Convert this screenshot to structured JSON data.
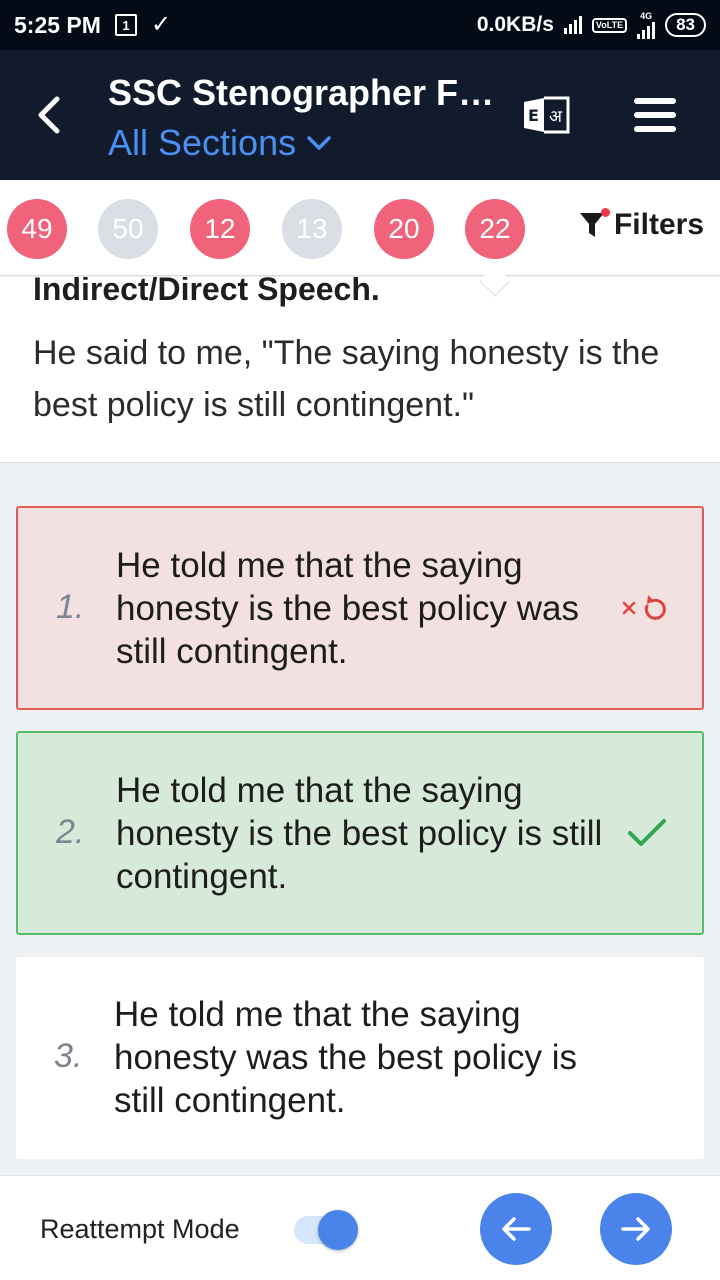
{
  "status_bar": {
    "time": "5:25 PM",
    "notif_box": "1",
    "network_speed": "0.0KB/s",
    "volte": "VoLTE",
    "net_type": "4G",
    "battery": "83"
  },
  "header": {
    "title": "SSC Stenographer Fu...",
    "sections_label": "All Sections",
    "icons": [
      "back-arrow-icon",
      "language-toggle-icon",
      "menu-icon"
    ]
  },
  "question_strip": {
    "chips": [
      {
        "label": "49",
        "state": "wrong"
      },
      {
        "label": "50",
        "state": "skip"
      },
      {
        "label": "12",
        "state": "wrong"
      },
      {
        "label": "13",
        "state": "skip"
      },
      {
        "label": "20",
        "state": "wrong"
      },
      {
        "label": "22",
        "state": "wrong"
      }
    ],
    "filters_label": "Filters"
  },
  "question": {
    "heading": "Indirect/Direct Speech.",
    "text": "He said to me, \"The saying honesty is the best policy is still contingent.\""
  },
  "options": [
    {
      "number": "1.",
      "text": "He told me that the saying honesty is the best policy was still contingent.",
      "state": "wrong"
    },
    {
      "number": "2.",
      "text": "He told me that the saying honesty is the best policy is still contingent.",
      "state": "correct"
    },
    {
      "number": "3.",
      "text": "He told me that the saying honesty was the best policy is still contingent.",
      "state": "none"
    }
  ],
  "bottom_bar": {
    "reattempt_label": "Reattempt Mode",
    "reattempt_on": true
  },
  "colors": {
    "header_bg": "#111b2c",
    "accent_blue": "#4a84ea",
    "wrong_red": "#f0637b",
    "correct_green": "#5bba6b"
  }
}
